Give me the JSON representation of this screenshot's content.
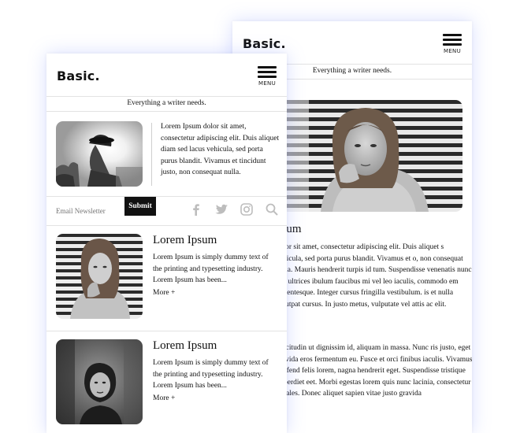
{
  "back_card": {
    "brand": "Basic.",
    "menu_label": "MENU",
    "tagline": "Everything a writer needs.",
    "article_title_fragment": "psum",
    "paragraph1": "dolor sit amet, consectetur adipiscing elit. Duis aliquet s vehicula, sed porta purus blandit. Vivamus et o, non consequat nulla. Mauris hendrerit turpis id tum. Suspendisse venenatis nunc nec ultrices ibulum faucibus mi vel leo iaculis, commodo em pellentesque. Integer cursus fringilla vestibulum. is et nulla volutpat cursus. In justo metus, vulputate vel attis ac elit.",
    "paragraph2": "ollicitudin ut dignissim id, aliquam in massa. Nunc ris justo, eget gravida eros fermentum eu. Fusce et orci finibus iaculis. Vivamus eleifend felis lorem, nagna hendrerit eget. Suspendisse tristique imperdiet eet. Morbi egestas lorem quis nunc lacinia, consectetur sodales. Donec aliquet sapien vitae justo gravida"
  },
  "front_card": {
    "brand": "Basic.",
    "menu_label": "MENU",
    "tagline": "Everything a writer needs.",
    "intro_text": "Lorem Ipsum dolor sit amet, consectetur adipiscing elit. Duis aliquet diam sed lacus vehicula, sed porta purus blandit. Vivamus et tincidunt justo, non consequat nulla.",
    "newsletter": {
      "placeholder": "Email Newsletter",
      "submit_label": "Submit"
    },
    "social_icons": [
      "facebook-icon",
      "twitter-icon",
      "instagram-icon",
      "search-icon"
    ],
    "posts": [
      {
        "title": "Lorem Ipsum",
        "excerpt": "Lorem Ipsum is simply dummy text of the printing and typesetting industry. Lorem Ipsum has been...",
        "more": "More +"
      },
      {
        "title": "Lorem Ipsum",
        "excerpt": "Lorem Ipsum is simply dummy text of the printing and typesetting industry. Lorem Ipsum has been...",
        "more": "More +"
      }
    ]
  },
  "colors": {
    "text": "#111111",
    "divider": "#e3e3e3",
    "button": "#111111",
    "icon": "#bdbdbd",
    "glow": "#788cff"
  }
}
